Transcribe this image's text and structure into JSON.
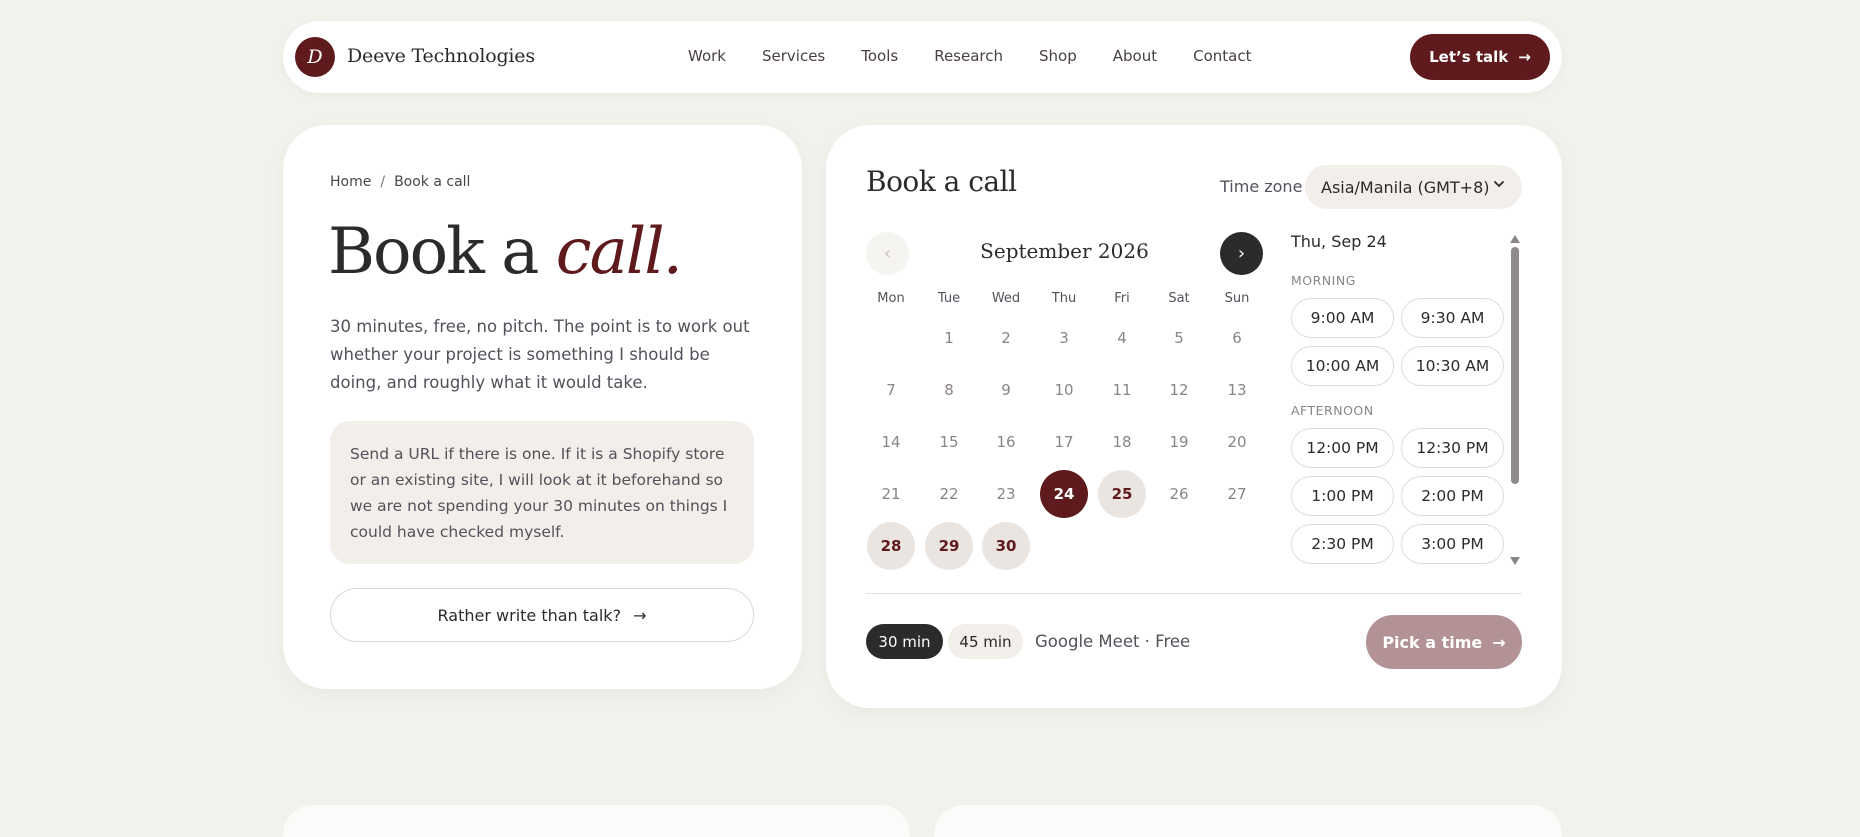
{
  "nav": {
    "logo_letter": "D",
    "brand": "Deeve Technologies",
    "links": [
      "Work",
      "Services",
      "Tools",
      "Research",
      "Shop",
      "About",
      "Contact"
    ],
    "cta": "Let’s talk",
    "cta_icon": "arrow-right-icon"
  },
  "intro": {
    "breadcrumb": [
      "Home",
      "Book a call"
    ],
    "breadcrumb_sep": "/",
    "headline_main": "Book a",
    "headline_accent": "call.",
    "lede": "30 minutes, free, no pitch. The point is to work out whether your project is something I should be doing, and roughly what it would take.",
    "note": "Send a URL if there is one. If it is a Shopify store or an existing site, I will look at it beforehand so we are not spending your 30 minutes on things I could have checked myself.",
    "write_button": "Rather write than talk?"
  },
  "booking": {
    "title": "Book a call",
    "timezone_label": "Time zone",
    "timezone_value": "Asia/Manila (GMT+8)",
    "prev_label": "‹",
    "next_label": "›",
    "month": "September 2026",
    "weekdays": [
      "Mon",
      "Tue",
      "Wed",
      "Thu",
      "Fri",
      "Sat",
      "Sun"
    ],
    "days": [
      "",
      "1",
      "2",
      "3",
      "4",
      "5",
      "6",
      "7",
      "8",
      "9",
      "10",
      "11",
      "12",
      "13",
      "14",
      "15",
      "16",
      "17",
      "18",
      "19",
      "20",
      "21",
      "22",
      "23",
      "24",
      "25",
      "26",
      "27",
      "28",
      "29",
      "30"
    ],
    "selected_day": "24",
    "available_days": [
      "25",
      "28",
      "29",
      "30"
    ],
    "slots_date": "Thu, Sep 24",
    "morning_label": "MORNING",
    "morning_slots": [
      "9:00 AM",
      "9:30 AM",
      "10:00 AM",
      "10:30 AM"
    ],
    "afternoon_label": "AFTERNOON",
    "afternoon_slots": [
      "12:00 PM",
      "12:30 PM",
      "1:00 PM",
      "2:00 PM",
      "2:30 PM",
      "3:00 PM"
    ],
    "durations": [
      "30 min",
      "45 min"
    ],
    "active_duration": "30 min",
    "meeting_info": "Google Meet · Free",
    "pick_button": "Pick a time"
  },
  "colors": {
    "accent": "#5e1a1c",
    "background": "#f3f1ec",
    "pick_button": "#b39295"
  }
}
